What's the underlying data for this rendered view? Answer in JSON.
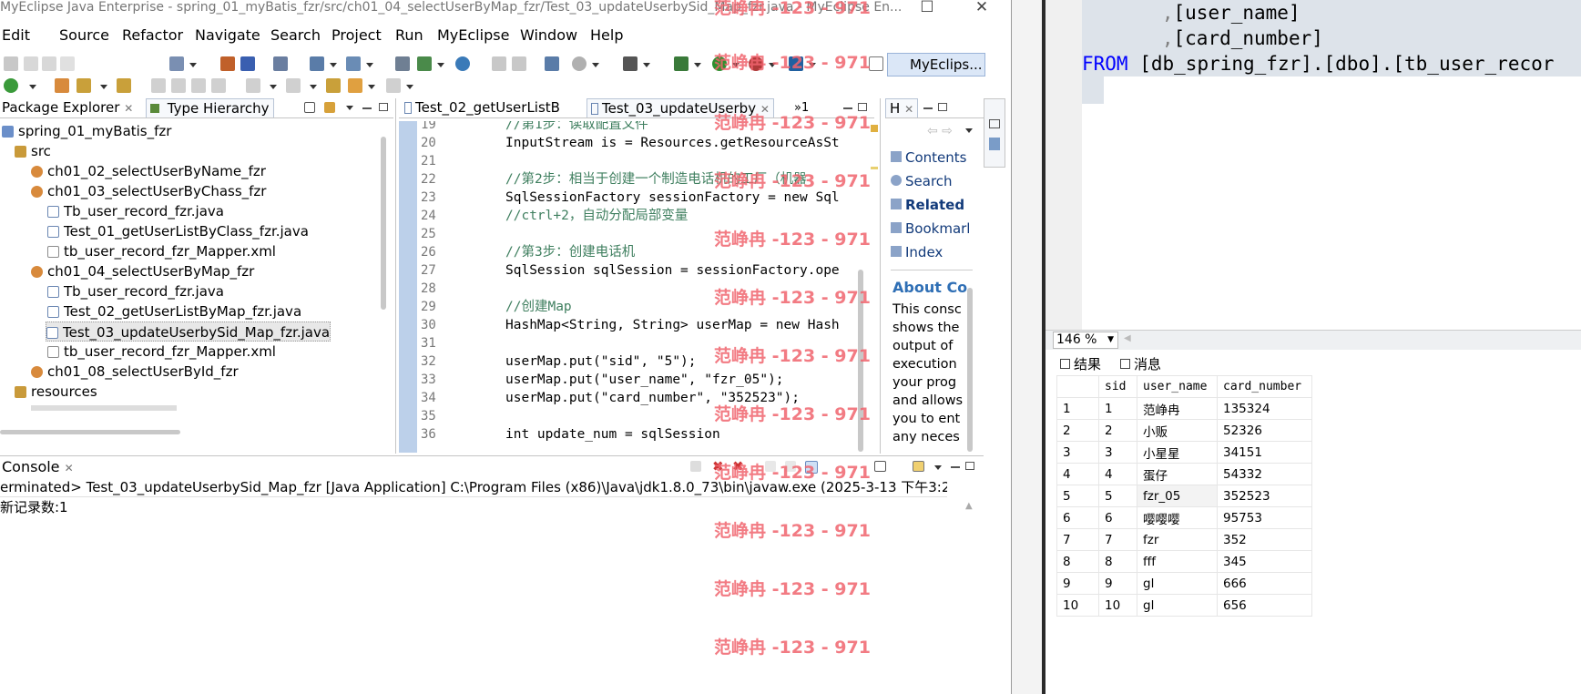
{
  "window": {
    "title": "MyEclipse Java Enterprise - spring_01_myBatis_fzr/src/ch01_04_selectUserByMap_fzr/Test_03_updateUserbySid_Map_fzr.java - MyEclipse En..."
  },
  "menu": [
    "Edit",
    "Source",
    "Refactor",
    "Navigate",
    "Search",
    "Project",
    "Run",
    "MyEclipse",
    "Window",
    "Help"
  ],
  "perspective": {
    "label": "MyEclips..."
  },
  "package_explorer": {
    "tab_label": "Package Explorer",
    "tab2_label": "Type Hierarchy",
    "items": [
      {
        "label": "spring_01_myBatis_fzr",
        "icon": "project-icon"
      },
      {
        "label": "src",
        "icon": "source-folder-icon"
      },
      {
        "label": "ch01_02_selectUserByName_fzr",
        "icon": "package-icon"
      },
      {
        "label": "ch01_03_selectUserByChass_fzr",
        "icon": "package-icon"
      },
      {
        "label": "Tb_user_record_fzr.java",
        "icon": "java-file-icon"
      },
      {
        "label": "Test_01_getUserListByClass_fzr.java",
        "icon": "java-file-icon"
      },
      {
        "label": "tb_user_record_fzr_Mapper.xml",
        "icon": "xml-file-icon"
      },
      {
        "label": "ch01_04_selectUserByMap_fzr",
        "icon": "package-icon"
      },
      {
        "label": "Tb_user_record_fzr.java",
        "icon": "java-file-icon"
      },
      {
        "label": "Test_02_getUserListByMap_fzr.java",
        "icon": "java-file-icon"
      },
      {
        "label": "Test_03_updateUserbySid_Map_fzr.java",
        "icon": "java-file-icon"
      },
      {
        "label": "tb_user_record_fzr_Mapper.xml",
        "icon": "xml-file-icon"
      },
      {
        "label": "ch01_08_selectUserById_fzr",
        "icon": "package-icon"
      },
      {
        "label": "resources",
        "icon": "resource-folder-icon"
      }
    ]
  },
  "editor": {
    "tabs": [
      {
        "label": "Test_02_getUserListB"
      },
      {
        "label": "Test_03_updateUserby"
      }
    ],
    "overflow_label": "»1",
    "lines": [
      {
        "n": "19",
        "c": "//第1步：读取配置文件"
      },
      {
        "n": "20",
        "c": "InputStream is = Resources.getResourceAsSt"
      },
      {
        "n": "21",
        "c": ""
      },
      {
        "n": "22",
        "c": "//第2步：相当于创建一个制造电话机的工厂（机器"
      },
      {
        "n": "23",
        "c": "SqlSessionFactory sessionFactory = new Sql"
      },
      {
        "n": "24",
        "c": "//ctrl+2，自动分配局部变量"
      },
      {
        "n": "25",
        "c": ""
      },
      {
        "n": "26",
        "c": "//第3步：创建电话机"
      },
      {
        "n": "27",
        "c": "SqlSession sqlSession = sessionFactory.ope"
      },
      {
        "n": "28",
        "c": ""
      },
      {
        "n": "29",
        "c": "//创建Map"
      },
      {
        "n": "30",
        "c": "HashMap<String, String> userMap = new Hash"
      },
      {
        "n": "31",
        "c": ""
      },
      {
        "n": "32",
        "c": "userMap.put(\"sid\", \"5\");"
      },
      {
        "n": "33",
        "c": "userMap.put(\"user_name\", \"fzr_05\");"
      },
      {
        "n": "34",
        "c": "userMap.put(\"card_number\", \"352523\");"
      },
      {
        "n": "35",
        "c": ""
      },
      {
        "n": "36",
        "c": "int update_num = sqlSession"
      }
    ]
  },
  "help": {
    "tab_label": "H",
    "items": [
      "Contents",
      "Search",
      "Related ",
      "Bookmarl",
      "Index"
    ],
    "about_title": "About Co",
    "about_lines": [
      "This consc",
      "shows the",
      "output of",
      "execution",
      "your prog",
      "and allows",
      "you to ent",
      "any neces"
    ]
  },
  "console": {
    "tab_label": "Console",
    "header": "erminated> Test_03_updateUserbySid_Map_fzr [Java Application] C:\\Program Files (x86)\\Java\\jdk1.8.0_73\\bin\\javaw.exe (2025-3-13 下午3:28:28)",
    "output": "新记录数:1"
  },
  "watermark": "范峥冉 -123 - 971",
  "ssms": {
    "sql_lines": [
      {
        "indent": "      ",
        "prefix": ",",
        "text": "[user_name]"
      },
      {
        "indent": "      ",
        "prefix": ",",
        "text": "[card_number]"
      }
    ],
    "from_keyword": "FROM",
    "from_target": "[db_spring_fzr].[dbo].[tb_user_recor",
    "zoom": "146 %",
    "result_tabs": [
      "结果",
      "消息"
    ],
    "columns": [
      "sid",
      "user_name",
      "card_number"
    ],
    "rows": [
      {
        "idx": "1",
        "sid": "1",
        "user_name": "范峥冉",
        "card_number": "135324"
      },
      {
        "idx": "2",
        "sid": "2",
        "user_name": "小贩",
        "card_number": "52326"
      },
      {
        "idx": "3",
        "sid": "3",
        "user_name": "小星星",
        "card_number": "34151"
      },
      {
        "idx": "4",
        "sid": "4",
        "user_name": "蛋仔",
        "card_number": "54332"
      },
      {
        "idx": "5",
        "sid": "5",
        "user_name": "fzr_05",
        "card_number": "352523"
      },
      {
        "idx": "6",
        "sid": "6",
        "user_name": "嘤嘤嘤",
        "card_number": "95753"
      },
      {
        "idx": "7",
        "sid": "7",
        "user_name": "fzr",
        "card_number": "352"
      },
      {
        "idx": "8",
        "sid": "8",
        "user_name": "fff",
        "card_number": "345"
      },
      {
        "idx": "9",
        "sid": "9",
        "user_name": "gl",
        "card_number": "666"
      },
      {
        "idx": "10",
        "sid": "10",
        "user_name": "gl",
        "card_number": "656"
      }
    ]
  }
}
